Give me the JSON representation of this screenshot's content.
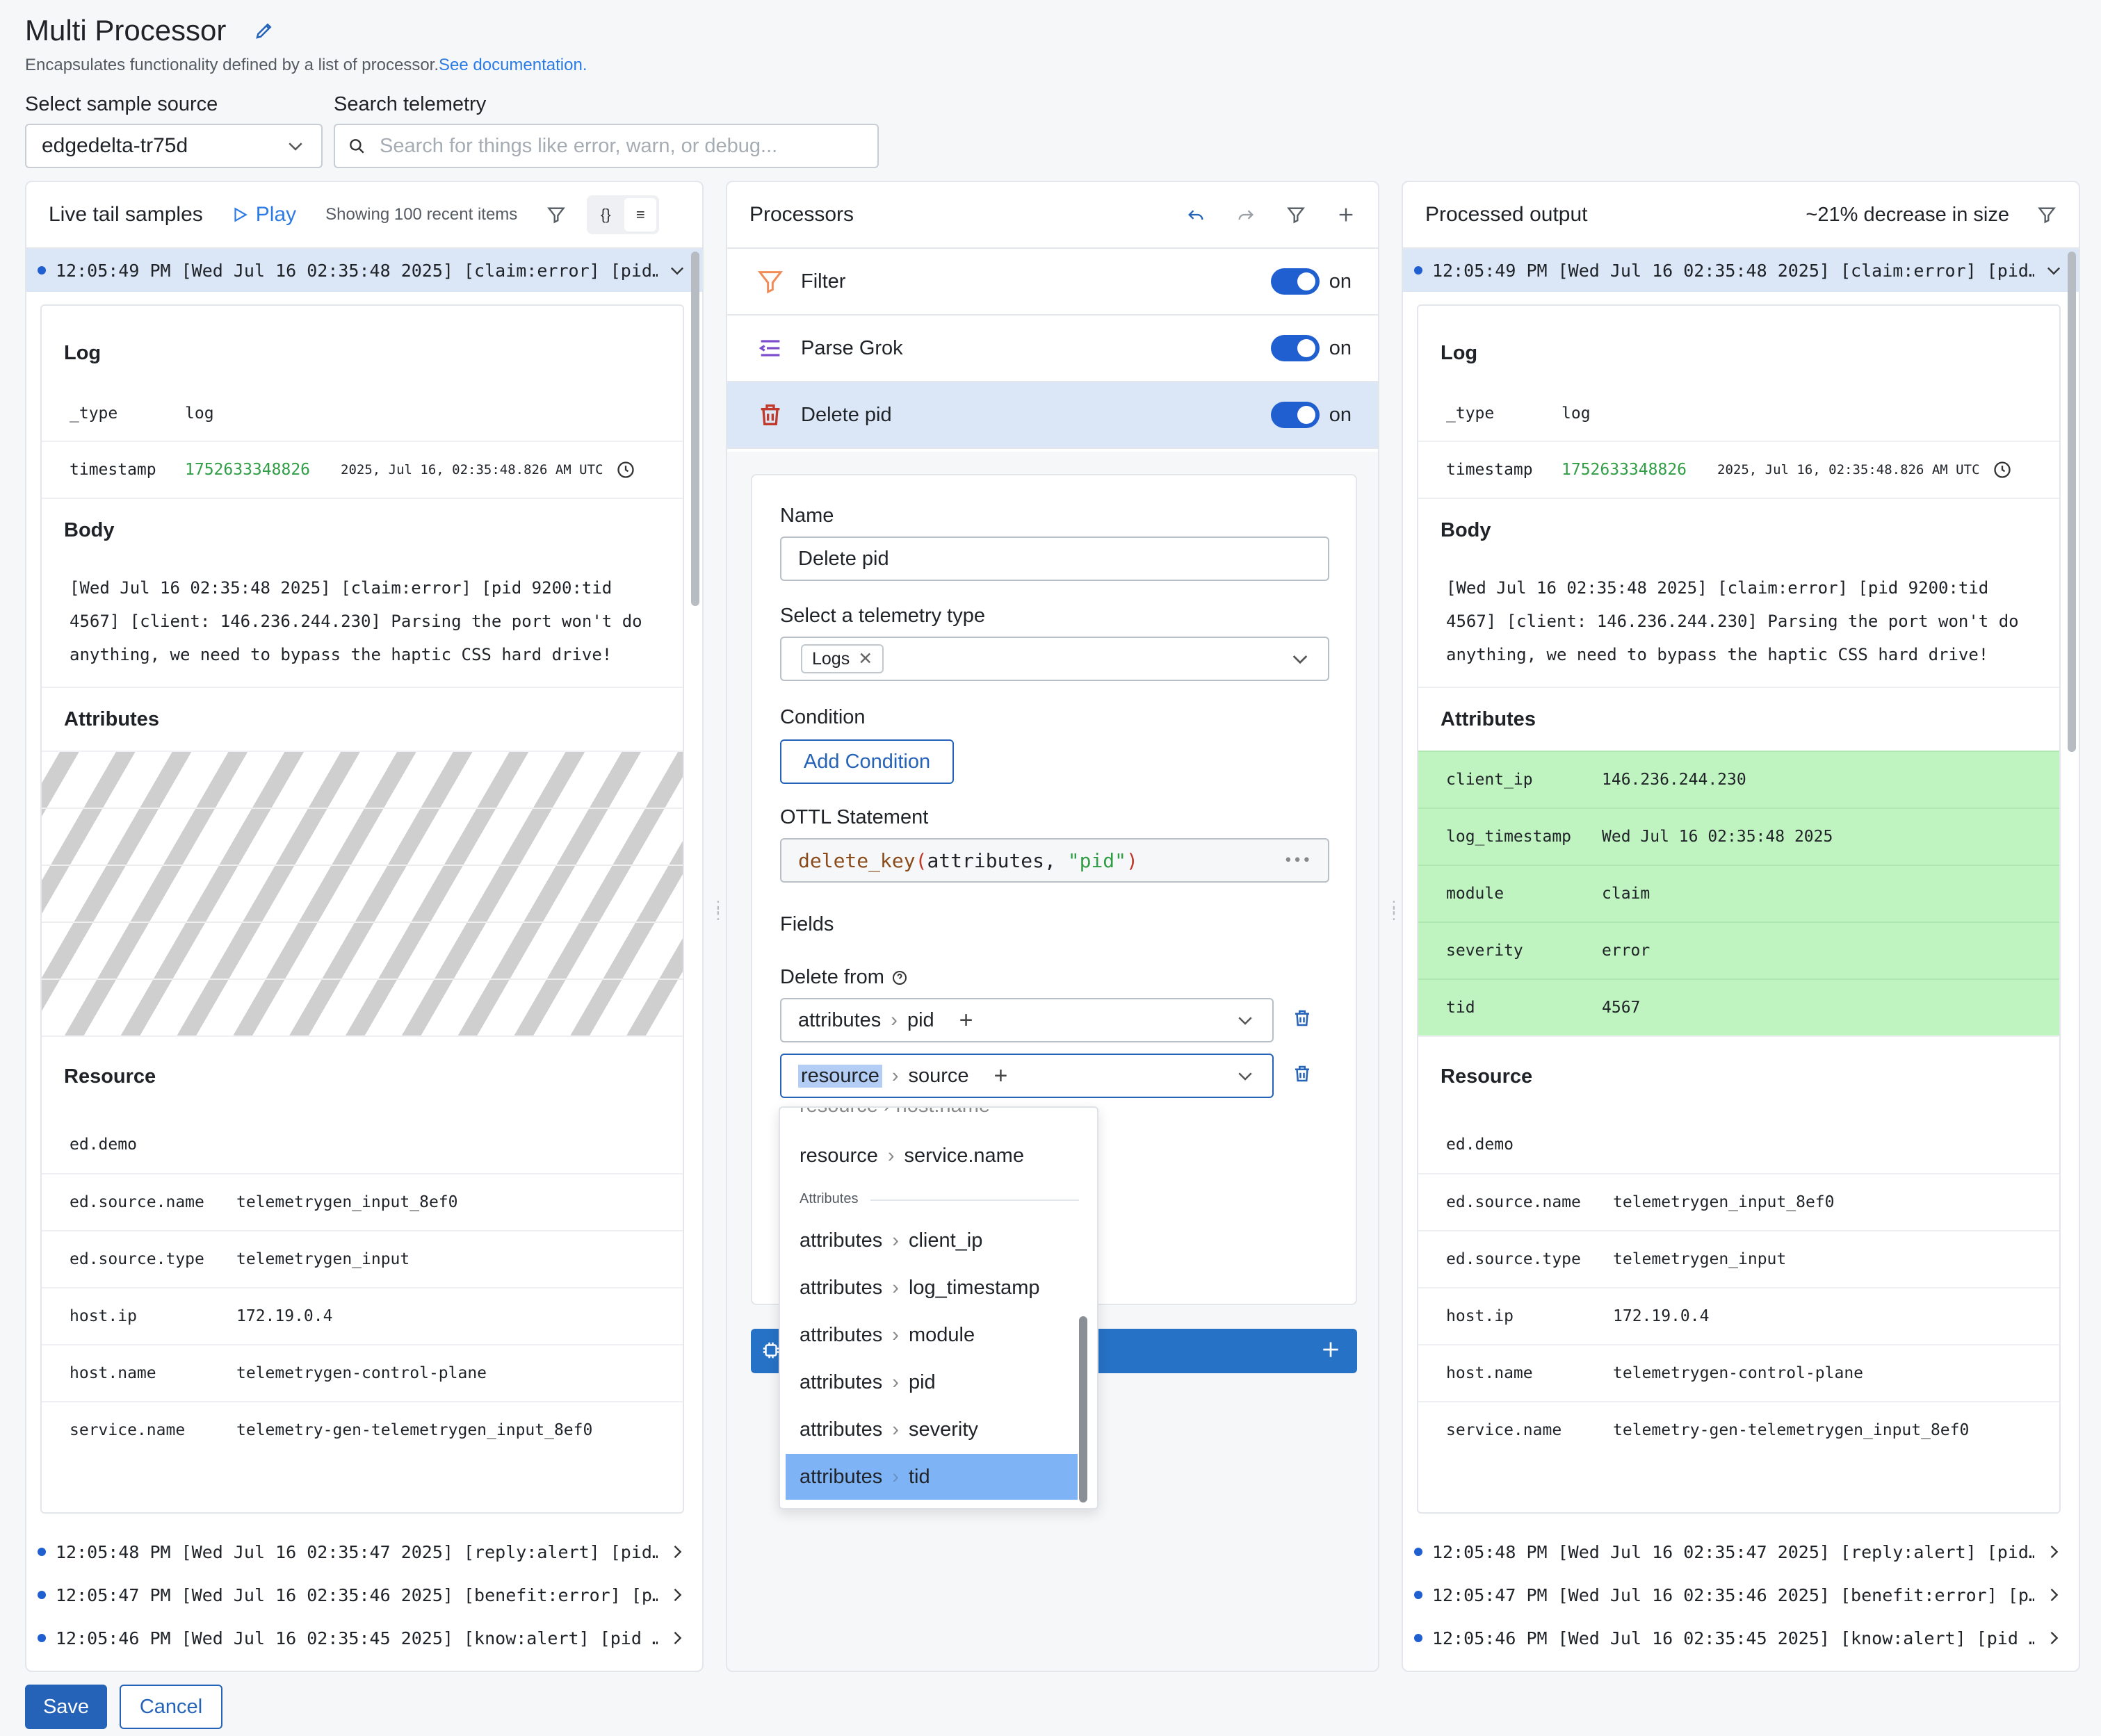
{
  "header": {
    "title": "Multi Processor",
    "subtitle": "Encapsulates functionality defined by a list of processor.",
    "doc_link": "See documentation.",
    "sample_source_label": "Select sample source",
    "sample_source_value": "edgedelta-tr75d",
    "search_label": "Search telemetry",
    "search_placeholder": "Search for things like error, warn, or debug..."
  },
  "live_tail": {
    "title": "Live tail samples",
    "play": "Play",
    "showing": "Showing 100 recent items",
    "selected_row": "12:05:49 PM [Wed Jul 16 02:35:48 2025] [claim:error] [pid…",
    "rows": [
      "12:05:48 PM [Wed Jul 16 02:35:47 2025] [reply:alert] [pid…",
      "12:05:47 PM [Wed Jul 16 02:35:46 2025] [benefit:error] [p…",
      "12:05:46 PM [Wed Jul 16 02:35:45 2025] [know:alert] [pid …"
    ],
    "log_title": "Log",
    "type_key": "_type",
    "type_value": "log",
    "timestamp_key": "timestamp",
    "timestamp_value": "1752633348826",
    "timestamp_human": "2025, Jul 16, 02:35:48.826 AM UTC",
    "body_title": "Body",
    "body_text": "[Wed Jul 16 02:35:48 2025] [claim:error] [pid 9200:tid 4567] [client: 146.236.244.230] Parsing the port won't do anything, we need to bypass the haptic CSS hard drive!",
    "attributes_title": "Attributes",
    "resource_title": "Resource",
    "resource": [
      {
        "k": "ed.demo",
        "v": ""
      },
      {
        "k": "ed.source.name",
        "v": "telemetrygen_input_8ef0"
      },
      {
        "k": "ed.source.type",
        "v": "telemetrygen_input"
      },
      {
        "k": "host.ip",
        "v": "172.19.0.4"
      },
      {
        "k": "host.name",
        "v": "telemetrygen-control-plane"
      },
      {
        "k": "service.name",
        "v": "telemetry-gen-telemetrygen_input_8ef0"
      }
    ]
  },
  "processors": {
    "title": "Processors",
    "items": [
      {
        "name": "Filter",
        "state": "on"
      },
      {
        "name": "Parse Grok",
        "state": "on"
      },
      {
        "name": "Delete pid",
        "state": "on"
      }
    ],
    "form": {
      "name_label": "Name",
      "name_value": "Delete pid",
      "telemetry_label": "Select a telemetry type",
      "telemetry_chip": "Logs",
      "condition_label": "Condition",
      "add_condition": "Add Condition",
      "ottl_label": "OTTL Statement",
      "ottl_fn": "delete_key",
      "ottl_open": "(",
      "ottl_arg": "attributes",
      "ottl_sep": ", ",
      "ottl_str": "\"pid\"",
      "ottl_close": ")",
      "fields_label": "Fields",
      "delete_from_label": "Delete from",
      "path1_a": "attributes",
      "path1_b": "pid",
      "path2_a": "resource",
      "path2_b": "source"
    },
    "dropdown": {
      "partial_top": "resource › host.name",
      "item_resource": "resource",
      "item_service": "service.name",
      "group_label": "Attributes",
      "attr_prefix": "attributes",
      "attr_items": [
        "client_ip",
        "log_timestamp",
        "module",
        "pid",
        "severity",
        "tid"
      ]
    }
  },
  "output": {
    "title": "Processed output",
    "size_change": "~21% decrease in size",
    "selected_row": "12:05:49 PM [Wed Jul 16 02:35:48 2025] [claim:error] [pid…",
    "rows": [
      "12:05:48 PM [Wed Jul 16 02:35:47 2025] [reply:alert] [pid…",
      "12:05:47 PM [Wed Jul 16 02:35:46 2025] [benefit:error] [p…",
      "12:05:46 PM [Wed Jul 16 02:35:45 2025] [know:alert] [pid …"
    ],
    "attributes": [
      {
        "k": "client_ip",
        "v": "146.236.244.230"
      },
      {
        "k": "log_timestamp",
        "v": "Wed Jul 16 02:35:48 2025"
      },
      {
        "k": "module",
        "v": "claim"
      },
      {
        "k": "severity",
        "v": "error"
      },
      {
        "k": "tid",
        "v": "4567"
      }
    ]
  },
  "footer": {
    "save": "Save",
    "cancel": "Cancel"
  },
  "colors": {
    "accent": "#2563b8",
    "selected": "#dbe7f7",
    "added_attr": "#bff4c0",
    "timestamp": "#2f9e44"
  }
}
